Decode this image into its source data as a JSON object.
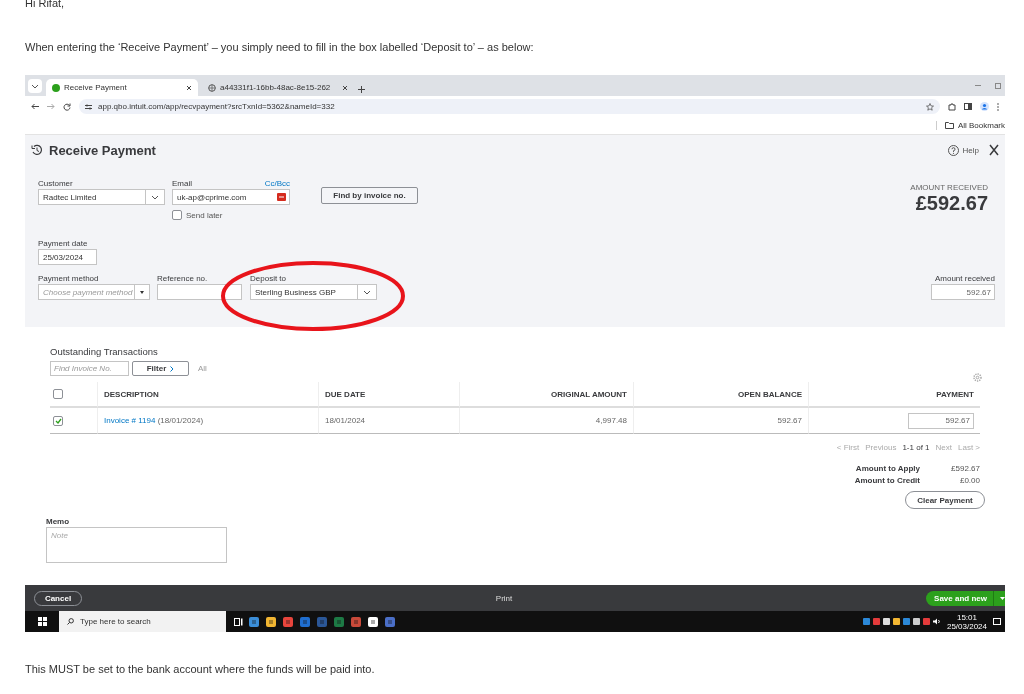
{
  "email": {
    "greeting": "Hi Rifat,",
    "intro": "When entering the ‘Receive Payment’ – you simply need to fill in the box labelled ‘Deposit to’ – as below:",
    "closing": "This MUST be set to the bank account where the funds will be paid into."
  },
  "browser": {
    "tabs": [
      {
        "title": "Receive Payment",
        "selected": true
      },
      {
        "title": "a44331f1-16bb-48ac-8e15-262",
        "selected": false
      }
    ],
    "url": "app.qbo.intuit.com/app/recvpayment?srcTxnId=5362&nameId=332",
    "bookmarks_label": "All Bookmark"
  },
  "page": {
    "title": "Receive Payment",
    "help": "Help",
    "customer": {
      "label": "Customer",
      "value": "Radtec Limited"
    },
    "email": {
      "label": "Email",
      "value": "uk-ap@cprime.com",
      "cc_link": "Cc/Bcc",
      "send_later": {
        "label": "Send later",
        "checked": false
      }
    },
    "find_button": "Find by invoice no.",
    "amount_received_caption": "AMOUNT RECEIVED",
    "amount_received_total": "£592.67",
    "payment_date": {
      "label": "Payment date",
      "value": "25/03/2024"
    },
    "payment_method": {
      "label": "Payment method",
      "placeholder": "Choose payment method"
    },
    "reference": {
      "label": "Reference no."
    },
    "deposit_to": {
      "label": "Deposit to",
      "value": "Sterling Business GBP"
    },
    "amount_received": {
      "label": "Amount received",
      "value": "592.67"
    }
  },
  "transactions": {
    "title": "Outstanding Transactions",
    "find_placeholder": "Find Invoice No.",
    "filter_button": "Filter",
    "filter_value": "All",
    "header_checked": false,
    "columns": [
      "DESCRIPTION",
      "DUE DATE",
      "ORIGINAL AMOUNT",
      "OPEN BALANCE",
      "PAYMENT"
    ],
    "rows": [
      {
        "checked": true,
        "invoice_link": "Invoice # 1194",
        "invoice_date": "(18/01/2024)",
        "due_date": "18/01/2024",
        "original_amount": "4,997.48",
        "open_balance": "592.67",
        "payment": "592.67"
      }
    ],
    "pagination": [
      "< First",
      "Previous",
      "1-1 of 1",
      "Next",
      "Last >"
    ],
    "totals": [
      {
        "label": "Amount to Apply",
        "value": "£592.67"
      },
      {
        "label": "Amount to Credit",
        "value": "£0.00"
      }
    ],
    "clear_button": "Clear Payment"
  },
  "memo": {
    "label": "Memo",
    "placeholder": "Note"
  },
  "footer": {
    "cancel": "Cancel",
    "print": "Print",
    "save": "Save and new"
  },
  "taskbar": {
    "search_placeholder": "Type here to search",
    "time": "15:01",
    "date": "25/03/2024"
  }
}
